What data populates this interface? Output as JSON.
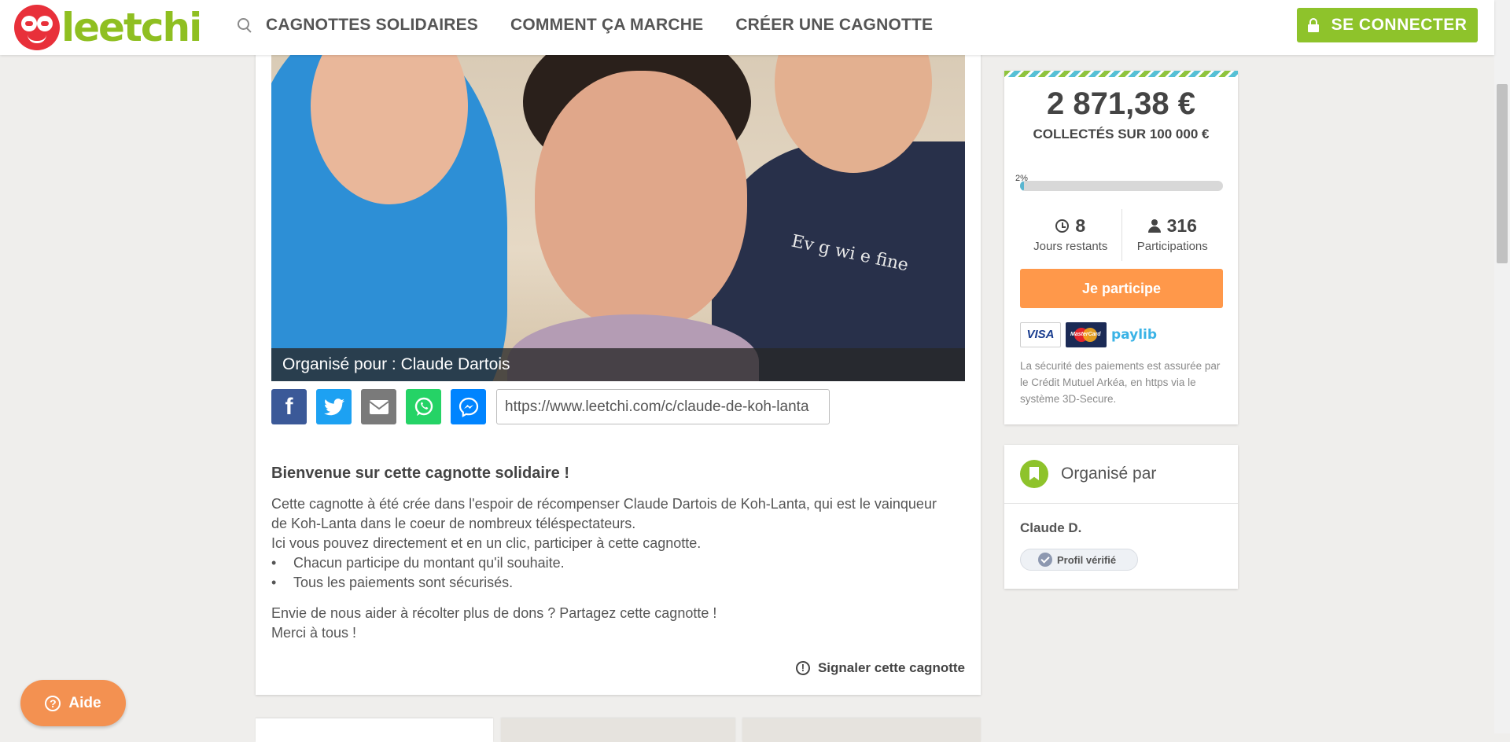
{
  "header": {
    "logo_text": "leetchi",
    "nav": [
      "CAGNOTTES SOLIDAIRES",
      "COMMENT ÇA MARCHE",
      "CRÉER UNE CAGNOTTE"
    ],
    "login_label": "SE CONNECTER"
  },
  "hero": {
    "caption": "Organisé pour : Claude Dartois",
    "shirt_text": "Ev   g wi   e fine"
  },
  "share": {
    "url": "https://www.leetchi.com/c/claude-de-koh-lanta"
  },
  "description": {
    "title": "Bienvenue sur cette cagnotte solidaire !",
    "line1": "Cette cagnotte à été crée dans l'espoir de récompenser Claude Dartois de Koh-Lanta, qui est le vainqueur de Koh-Lanta dans le coeur de nombreux téléspectateurs.",
    "line2": "Ici vous pouvez directement et en un clic, participer à cette cagnotte.",
    "bullets": [
      "Chacun participe du montant qu'il souhaite.",
      "Tous les paiements sont sécurisés."
    ],
    "line3": "Envie de nous aider à récolter plus de dons ? Partagez cette cagnotte !",
    "line4": "Merci à tous !"
  },
  "report_label": "Signaler cette cagnotte",
  "funding": {
    "amount": "2 871,38 €",
    "collected": "COLLECTÉS SUR 100 000 €",
    "percent_label": "2%",
    "progress_fraction": 0.02,
    "days_value": "8",
    "days_label": "Jours restants",
    "participations_value": "316",
    "participations_label": "Participations",
    "cta": "Je participe",
    "pay_visa": "VISA",
    "pay_mc": "MasterCard",
    "pay_lib": "paylib",
    "security_text": "La sécurité des paiements est assurée par le Crédit Mutuel Arkéa, en https via le système 3D-Secure."
  },
  "organizer": {
    "title": "Organisé par",
    "name": "Claude D.",
    "verified": "Profil vérifié"
  },
  "help_label": "Aide",
  "colors": {
    "brand_green": "#8ec32b",
    "cta_orange": "#ff984a",
    "progress_blue": "#5ab6d0",
    "logo_red": "#e8303a"
  }
}
